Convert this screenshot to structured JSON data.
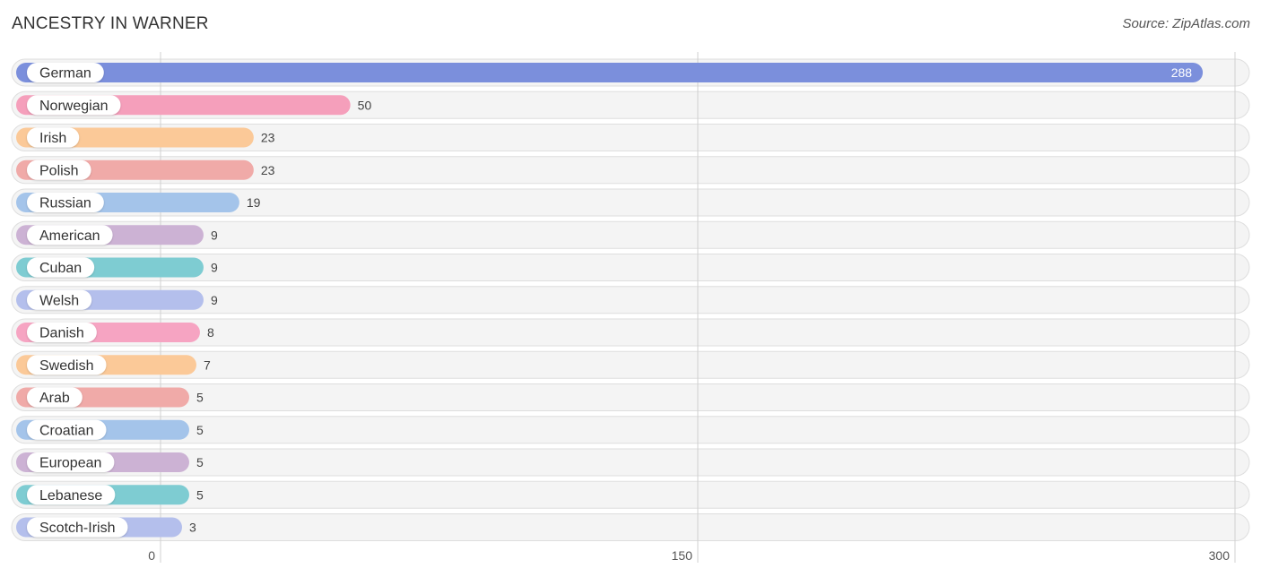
{
  "header": {
    "title": "ANCESTRY IN WARNER",
    "source": "Source: ZipAtlas.com"
  },
  "chart_data": {
    "type": "bar",
    "orientation": "horizontal",
    "title": "ANCESTRY IN WARNER",
    "xlabel": "",
    "ylabel": "",
    "xlim": [
      0,
      300
    ],
    "xticks": [
      0,
      150,
      300
    ],
    "xtick_labels": [
      "0",
      "150",
      "300"
    ],
    "grid": true,
    "legend": "none",
    "categories": [
      "German",
      "Norwegian",
      "Irish",
      "Polish",
      "Russian",
      "American",
      "Cuban",
      "Welsh",
      "Danish",
      "Swedish",
      "Arab",
      "Croatian",
      "European",
      "Lebanese",
      "Scotch-Irish"
    ],
    "values": [
      288,
      50,
      23,
      23,
      19,
      9,
      9,
      9,
      8,
      7,
      5,
      5,
      5,
      5,
      3
    ],
    "value_labels": [
      "288",
      "50",
      "23",
      "23",
      "19",
      "9",
      "9",
      "9",
      "8",
      "7",
      "5",
      "5",
      "5",
      "5",
      "3"
    ],
    "colors": [
      "#7b8fdc",
      "#f59fbb",
      "#fbc998",
      "#f0aaa8",
      "#a4c4ea",
      "#ccb2d4",
      "#7eccd2",
      "#b4bfec",
      "#f6a4c2",
      "#fbc998",
      "#f0aaa8",
      "#a4c4ea",
      "#ccb2d4",
      "#7eccd2",
      "#b4bfec"
    ]
  }
}
